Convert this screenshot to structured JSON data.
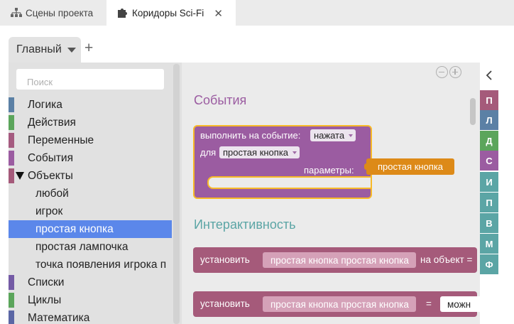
{
  "tabs": [
    {
      "label": "Сцены проекта",
      "icon": "hierarchy-icon"
    },
    {
      "label": "Коридоры Sci-Fi",
      "icon": "puzzle-icon",
      "close": "✕"
    }
  ],
  "main_tab": {
    "label": "Главный",
    "add": "+"
  },
  "search": {
    "placeholder": "Поиск"
  },
  "categories": [
    {
      "label": "Логика",
      "color": "#5b80a5"
    },
    {
      "label": "Действия",
      "color": "#5ba55b"
    },
    {
      "label": "Переменные",
      "color": "#a55b80"
    },
    {
      "label": "События",
      "color": "#9b5ca1"
    },
    {
      "label": "Объекты",
      "color": "#a55a7a"
    }
  ],
  "object_items": [
    "любой",
    "игрок",
    "простая кнопка",
    "простая лампочка",
    "точка появления игрока п"
  ],
  "selected_item": "простая кнопка",
  "categories_after": [
    {
      "label": "Списки",
      "color": "#745ba5"
    },
    {
      "label": "Циклы",
      "color": "#5ba55b"
    },
    {
      "label": "Математика",
      "color": "#5b67a5"
    }
  ],
  "flyout": {
    "section_events": "События",
    "section_interactivity": "Интерактивность",
    "event_block": {
      "label1": "выполнить на событие:",
      "event_value": "нажата",
      "label2": "для",
      "object_value": "простая кнопка",
      "params_label": "параметры:",
      "param_value": "простая кнопка"
    },
    "set_block_1": {
      "label": "установить",
      "value": "простая кнопка простая кнопка",
      "suffix": "на объект ="
    },
    "set_block_2": {
      "label": "установить",
      "value": "простая кнопка простая кнопка",
      "eq": "=",
      "value2": "можн"
    }
  },
  "colors": {
    "events_header": "#9b5ca1",
    "interactivity_header": "#5ba5a5",
    "selected": "#5b87ea",
    "param_orange": "#dd8a18",
    "highlight": "#f7b928"
  },
  "right_tabs": [
    {
      "label": "П",
      "color": "#a55a7a"
    },
    {
      "label": "Л",
      "color": "#5b80a5"
    },
    {
      "label": "Д",
      "color": "#5ba55b"
    },
    {
      "label": "С",
      "color": "#9b5ca1"
    },
    {
      "label": "И",
      "color": "#5ba5a5"
    },
    {
      "label": "П",
      "color": "#5ba5a5"
    },
    {
      "label": "В",
      "color": "#5ba5a5"
    },
    {
      "label": "М",
      "color": "#5ba5a5"
    },
    {
      "label": "Ф",
      "color": "#5ba5a5"
    }
  ]
}
